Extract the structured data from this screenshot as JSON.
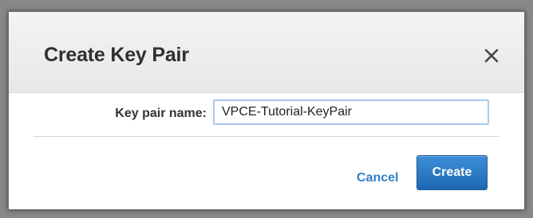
{
  "dialog": {
    "title": "Create Key Pair",
    "close_icon": "close-icon",
    "form": {
      "key_pair_name_label": "Key pair name:",
      "key_pair_name_value": "VPCE-Tutorial-KeyPair"
    },
    "footer": {
      "cancel_label": "Cancel",
      "create_label": "Create"
    }
  },
  "colors": {
    "primary_button": "#1f66b2",
    "link": "#2f7fc5",
    "input_focus_border": "#a8c8ea",
    "header_background": "#efefef"
  }
}
